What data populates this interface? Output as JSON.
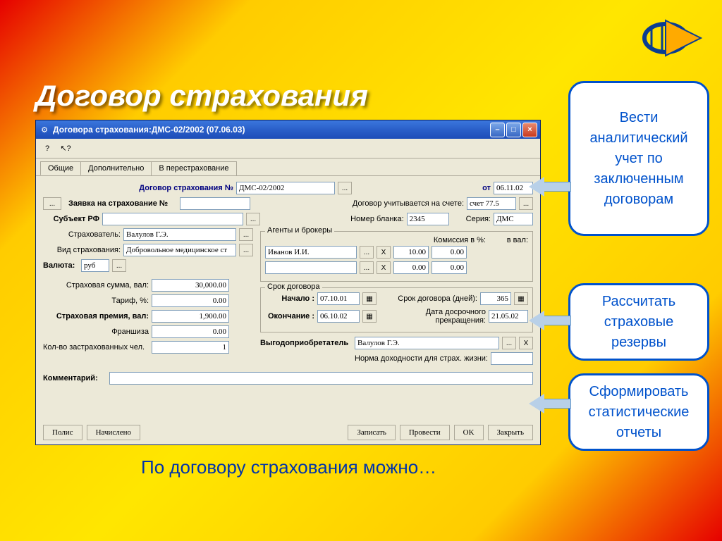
{
  "slide": {
    "title": "Договор страхования",
    "caption": "По договору страхования можно…"
  },
  "callouts": {
    "c1": "Вести аналитический учет по заключенным договорам",
    "c2": "Рассчитать страховые резервы",
    "c3": "Сформировать статистические отчеты"
  },
  "window": {
    "title": "Договора страхования:ДМС-02/2002 (07.06.03)",
    "tabs": [
      "Общие",
      "Дополнительно",
      "В перестрахование"
    ]
  },
  "form": {
    "contract_label": "Договор страхования №",
    "contract_no": "ДМС-02/2002",
    "from_label": "от",
    "from_date": "06.11.02",
    "request_btn": "...",
    "request_label": "Заявка на страхование №",
    "request_no": "",
    "accounted_label": "Договор учитывается на счете:",
    "account": "счет 77.5",
    "subject_label": "Субъект РФ",
    "subject": "",
    "blank_no_label": "Номер бланка:",
    "blank_no": "2345",
    "series_label": "Серия:",
    "series": "ДМС",
    "insurer_label": "Страхователь:",
    "insurer": "Валулов Г.Э.",
    "ins_type_label": "Вид страхования:",
    "ins_type": "Добровольное медицинское ст",
    "currency_label": "Валюта:",
    "currency": "руб",
    "agents_legend": "Агенты и брокеры",
    "commission_pct_label": "Комиссия в %:",
    "commission_val_label": "в вал:",
    "agent_name": "Иванов И.И.",
    "agent_pct": "10.00",
    "agent_val": "0.00",
    "agent2_pct": "0.00",
    "agent2_val": "0.00",
    "sum_label": "Страховая сумма, вал:",
    "sum": "30,000.00",
    "tariff_label": "Тариф, %:",
    "tariff": "0.00",
    "premium_label": "Страховая премия, вал:",
    "premium": "1,900.00",
    "franchise_label": "Франшиза",
    "franchise": "0.00",
    "insured_count_label": "Кол-во застрахованных чел.",
    "insured_count": "1",
    "term_legend": "Срок договора",
    "start_label": "Начало :",
    "start_date": "07.10.01",
    "end_label": "Окончание :",
    "end_date": "06.10.02",
    "term_days_label": "Срок договора (дней):",
    "term_days": "365",
    "early_term_label": "Дата досрочного прекращения:",
    "early_term": "21.05.02",
    "benef_label": "Выгодоприобретатель",
    "benef": "Валулов Г.Э.",
    "yield_label": "Норма доходности для страх. жизни:",
    "yield": "",
    "comment_label": "Комментарий:",
    "comment": ""
  },
  "buttons": {
    "policy": "Полис",
    "accrued": "Начислено",
    "save": "Записать",
    "post": "Провести",
    "ok": "OK",
    "close": "Закрыть"
  }
}
